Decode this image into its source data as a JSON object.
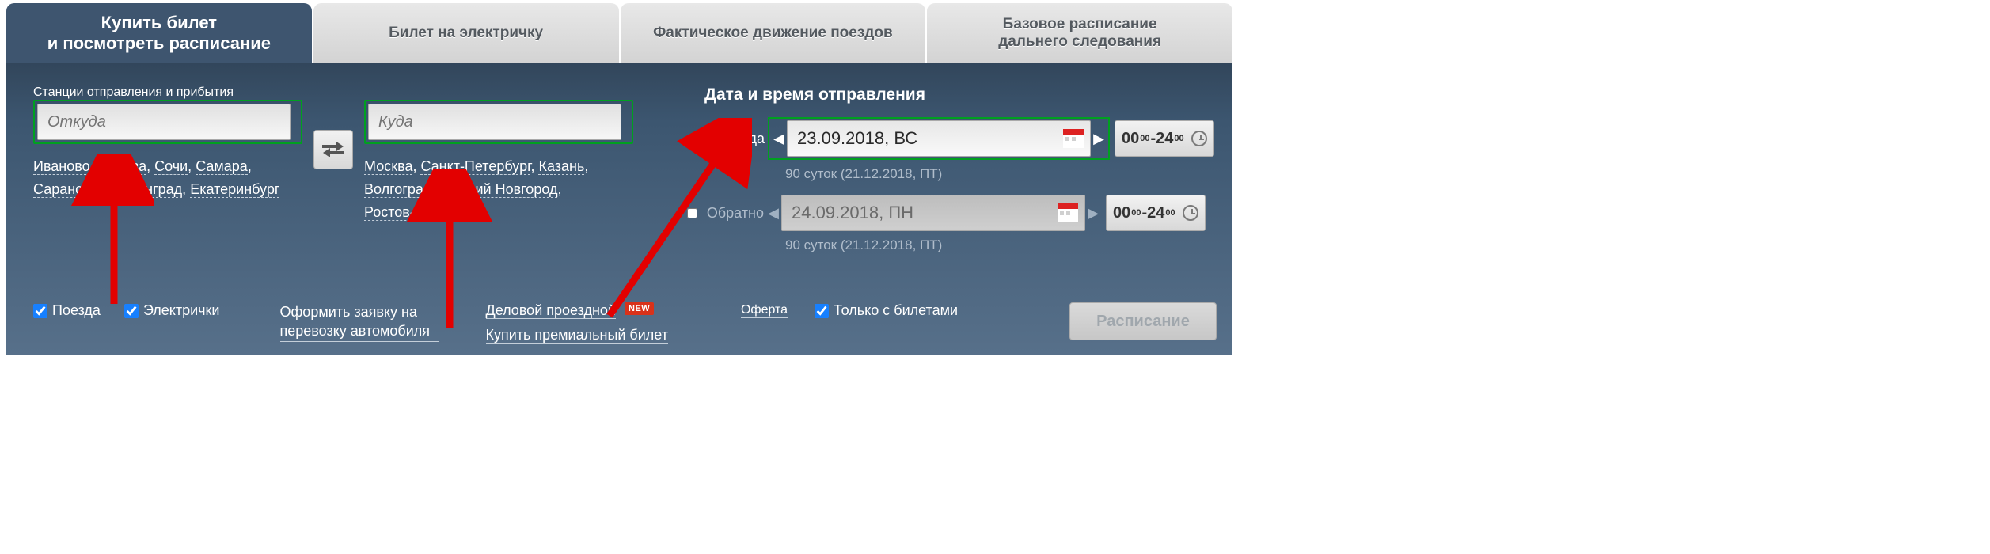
{
  "tabs": {
    "buy": "Купить билет\nи посмотреть расписание",
    "suburban": "Билет на электричку",
    "movement": "Фактическое движение поездов",
    "base": "Базовое расписание\nдальнего следования"
  },
  "stations": {
    "heading": "Станции отправления и прибытия",
    "from_placeholder": "Откуда",
    "to_placeholder": "Куда",
    "from_suggest": [
      "Иваново",
      "Москва",
      "Сочи",
      "Самара",
      "Саранск",
      "Калининград",
      "Екатеринбург"
    ],
    "to_suggest": [
      "Москва",
      "Санкт-Петербург",
      "Казань",
      "Волгоград",
      "Нижний Новгород",
      "Ростов-На-Дону"
    ]
  },
  "datetime": {
    "heading": "Дата и время отправления",
    "there_label": "Туда",
    "back_label": "Обратно",
    "there_date": "23.09.2018, ВС",
    "back_date": "24.09.2018, ПН",
    "sub_there": "90 суток (21.12.2018, ПТ)",
    "sub_back": "90 суток (21.12.2018, ПТ)",
    "time_from_h": "00",
    "time_from_m": "00",
    "time_sep": "-",
    "time_to_h": "24",
    "time_to_m": "00"
  },
  "footer": {
    "trains": "Поезда",
    "suburban": "Электрички",
    "car_request": "Оформить заявку на перевозку автомобиля",
    "business": "Деловой проездной",
    "new_badge": "NEW",
    "premium": "Купить премиальный билет",
    "offer": "Оферта",
    "tickets_only": "Только с билетами",
    "schedule_btn": "Расписание"
  }
}
